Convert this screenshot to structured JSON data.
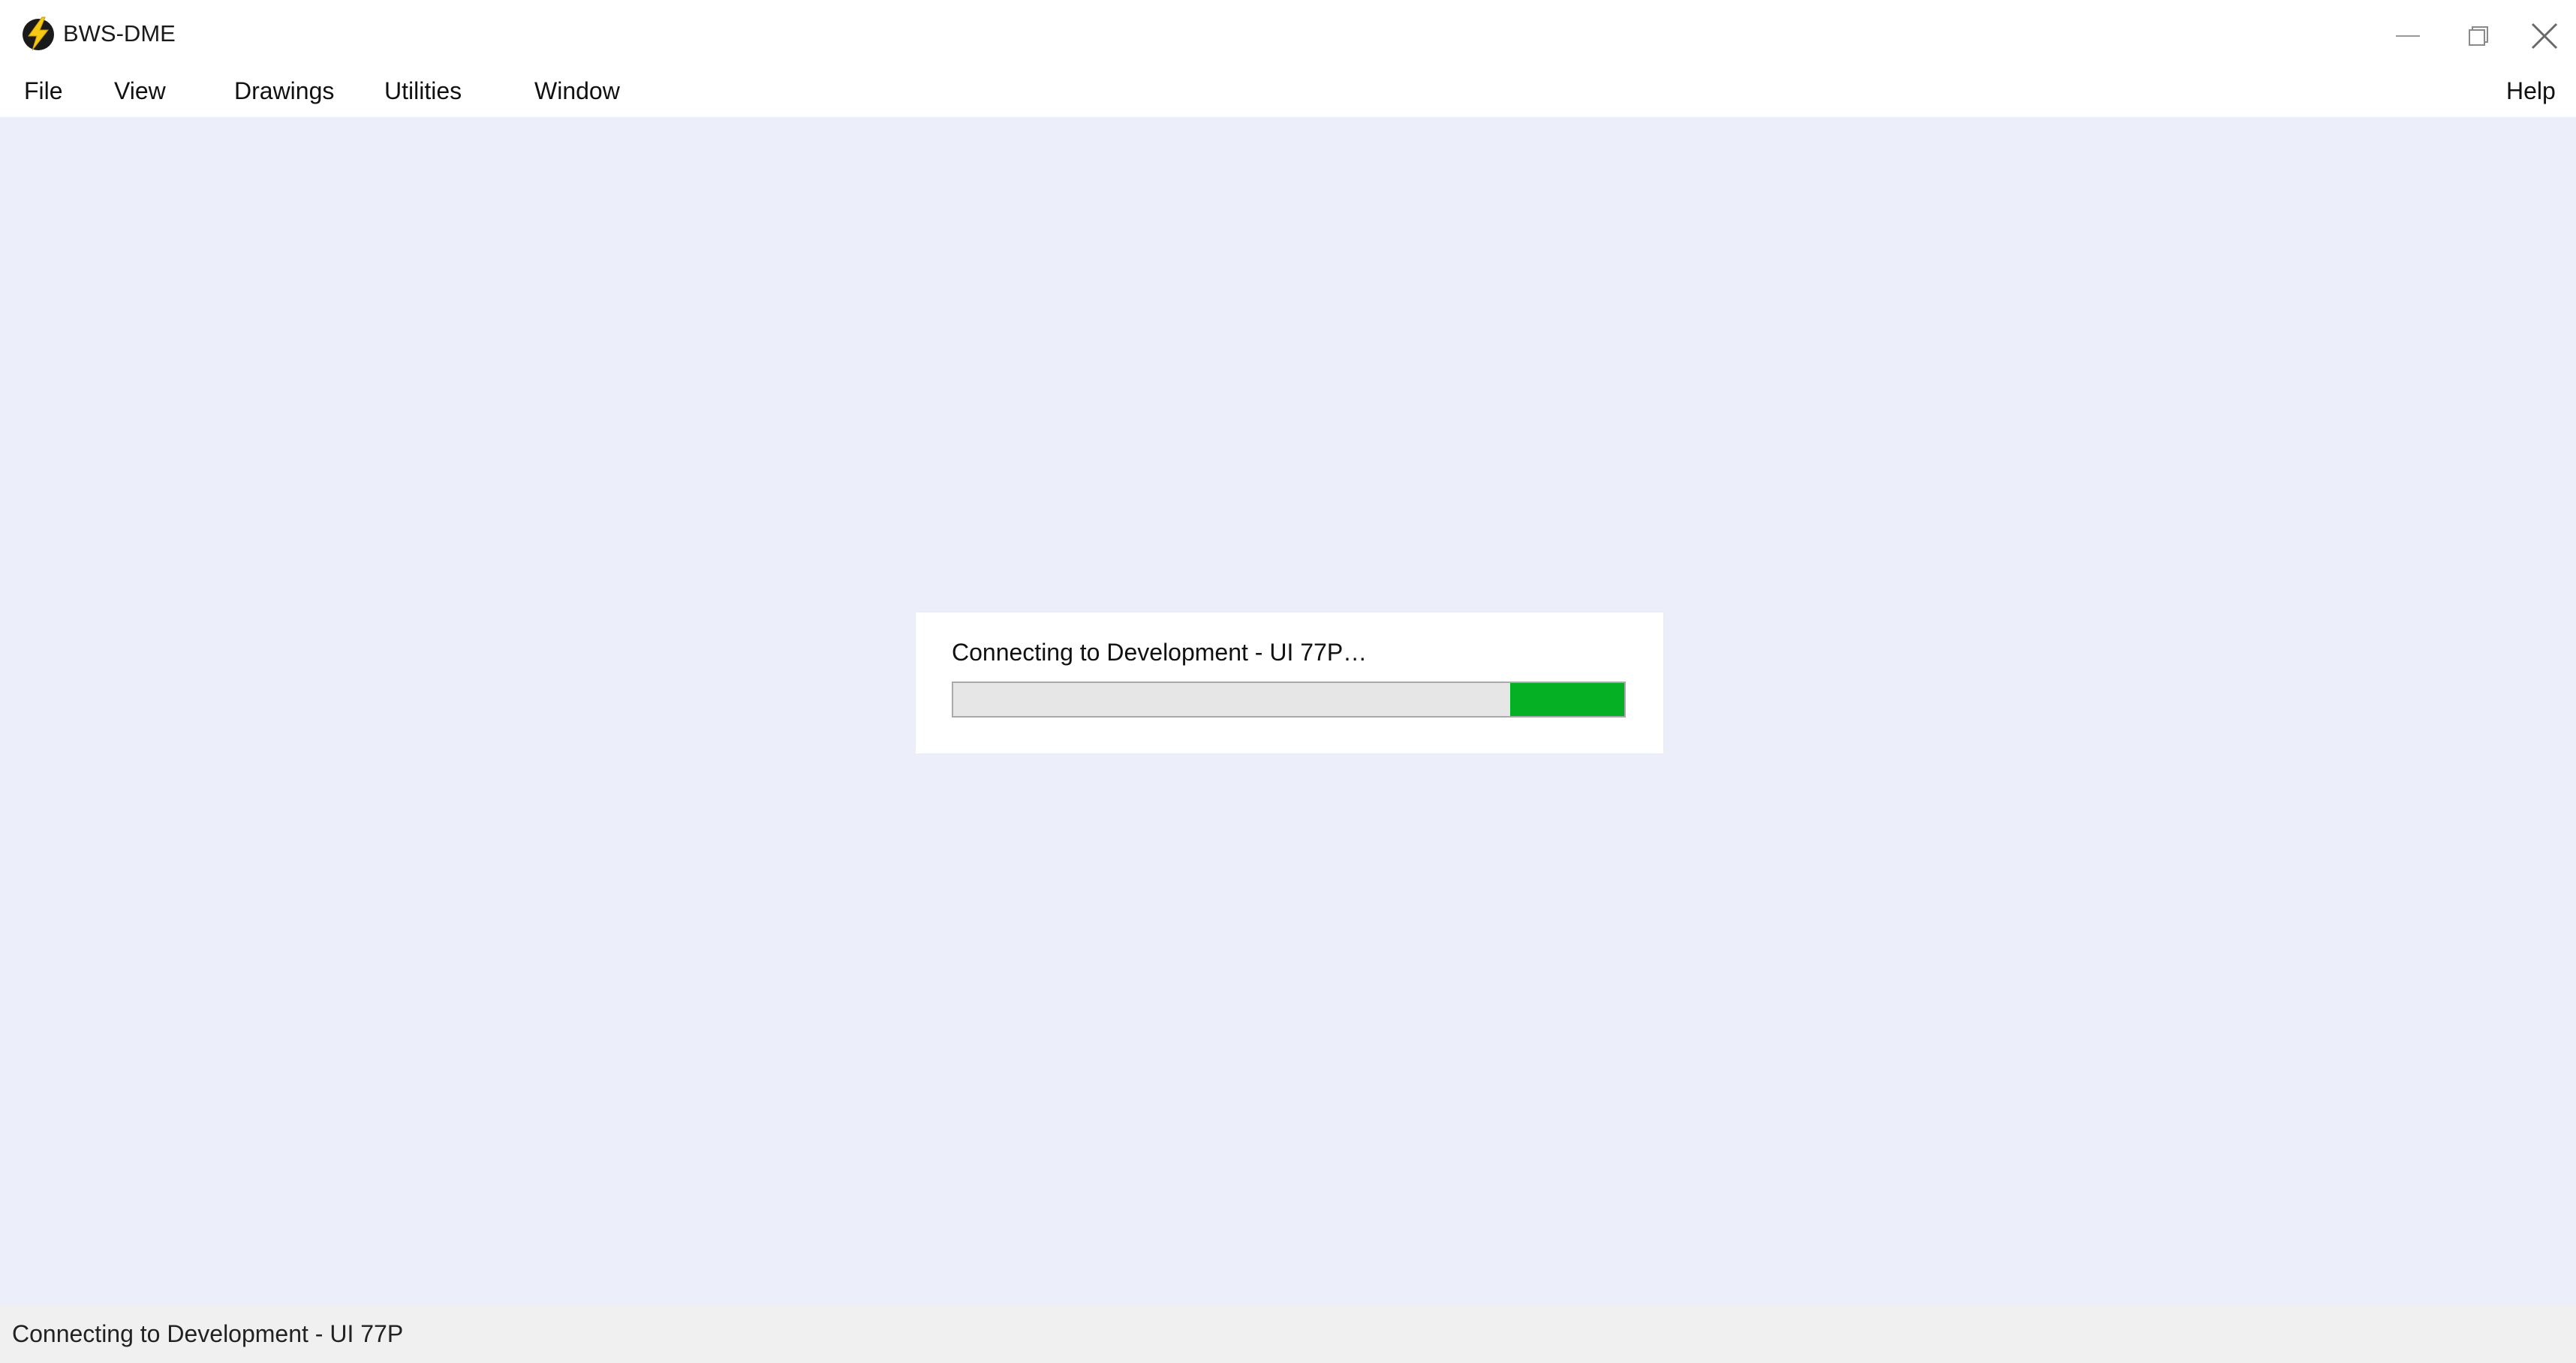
{
  "window": {
    "title": "BWS-DME",
    "logo_icon": "lightning-bolt-icon",
    "controls": {
      "minimize_icon": "minimize-icon",
      "maximize_icon": "restore-icon",
      "close_icon": "close-icon"
    }
  },
  "menu": {
    "file": "File",
    "view": "View",
    "drawings": "Drawings",
    "utilities": "Utilities",
    "window": "Window",
    "help": "Help"
  },
  "dialog": {
    "message": "Connecting to Development - UI 77P…",
    "progress": {
      "fill_start_fraction": 0.83,
      "fill_end_fraction": 1.0,
      "fill_color": "#06b025",
      "track_color": "#e6e6e6"
    }
  },
  "statusbar": {
    "text": "Connecting to Development - UI 77P"
  },
  "colors": {
    "workspace_background": "#eceff9",
    "statusbar_background": "#f0f0f0"
  }
}
